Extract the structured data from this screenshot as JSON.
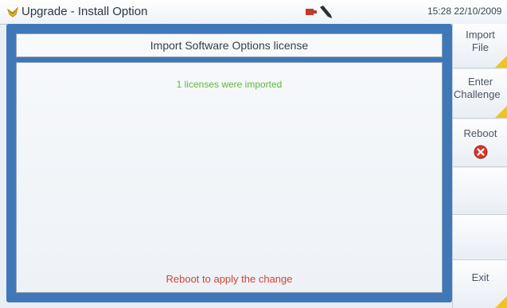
{
  "titlebar": {
    "title": "Upgrade - Install Option",
    "clock": "15:28 22/10/2009"
  },
  "dialog": {
    "header": "Import Software Options license",
    "message": "1 licenses were imported",
    "reboot_message": "Reboot to apply the change"
  },
  "sidebar": {
    "import_file_line1": "Import",
    "import_file_line2": "File",
    "enter_challenge_line1": "Enter",
    "enter_challenge_line2": "Challenge",
    "reboot_label": "Reboot",
    "exit_label": "Exit"
  },
  "colors": {
    "accent": "#3f78b9",
    "success": "#5fb936",
    "warning": "#d04536",
    "corner": "#f0c419"
  }
}
